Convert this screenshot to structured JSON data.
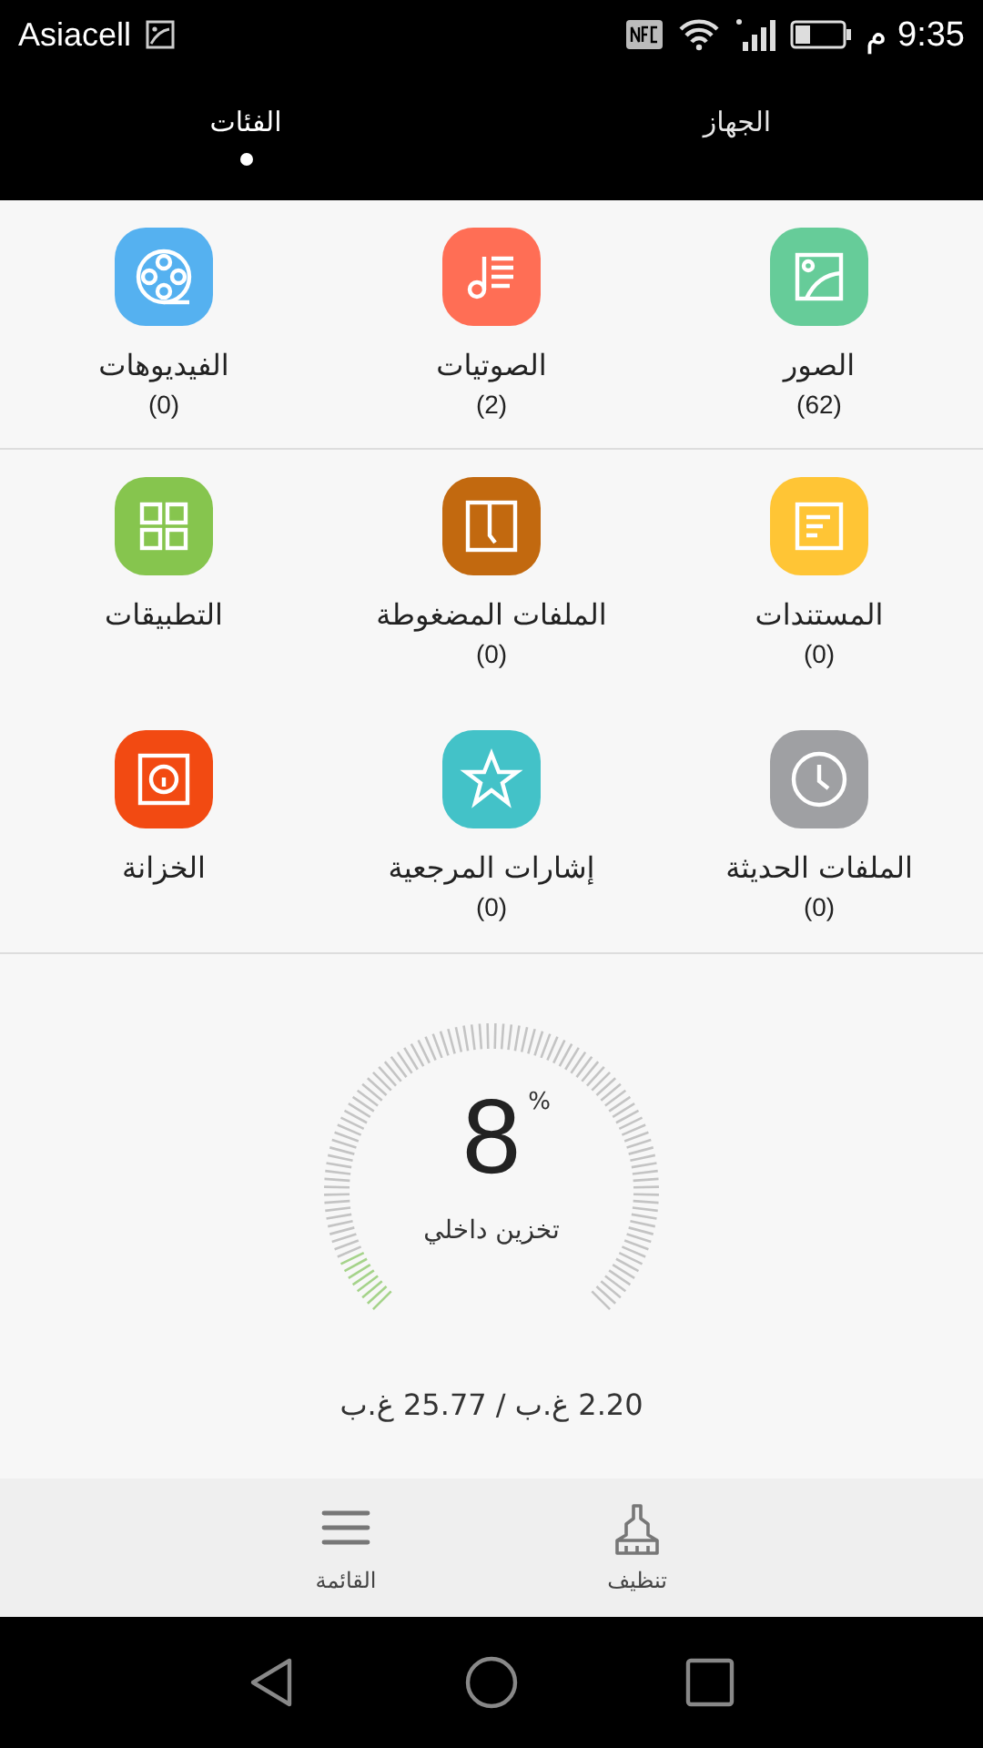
{
  "status_bar": {
    "carrier": "Asiacell",
    "time": "9:35 م"
  },
  "tabs": [
    {
      "label": "الجهاز",
      "selected": false
    },
    {
      "label": "الفئات",
      "selected": true
    }
  ],
  "category_groups": [
    {
      "items": [
        {
          "kind": "image",
          "color": "#66cc99",
          "label": "الصور",
          "count": "(62)"
        },
        {
          "kind": "music",
          "color": "#ff6e55",
          "label": "الصوتيات",
          "count": "(2)"
        },
        {
          "kind": "video",
          "color": "#55b1f0",
          "label": "الفيديوهات",
          "count": "(0)"
        }
      ]
    },
    {
      "items": [
        {
          "kind": "document",
          "color": "#ffc535",
          "label": "المستندات",
          "count": "(0)"
        },
        {
          "kind": "archive",
          "color": "#c2690f",
          "label": "الملفات المضغوطة",
          "count": "(0)"
        },
        {
          "kind": "apps",
          "color": "#86c54e",
          "label": "التطبيقات"
        },
        {
          "kind": "clock",
          "color": "#9fa0a3",
          "label": "الملفات الحديثة",
          "count": "(0)"
        },
        {
          "kind": "star",
          "color": "#43c2c8",
          "label": "إشارات المرجعية",
          "count": "(0)"
        },
        {
          "kind": "safe",
          "color": "#f24a12",
          "label": "الخزانة"
        }
      ]
    }
  ],
  "storage": {
    "percent": "8",
    "unit": "%",
    "label": "تخزين داخلي",
    "usage": "2.20 غ.ب / 25.77 غ.ب"
  },
  "bottom_bar": [
    {
      "kind": "clean",
      "label": "تنظيف"
    },
    {
      "kind": "menu",
      "label": "القائمة"
    }
  ]
}
